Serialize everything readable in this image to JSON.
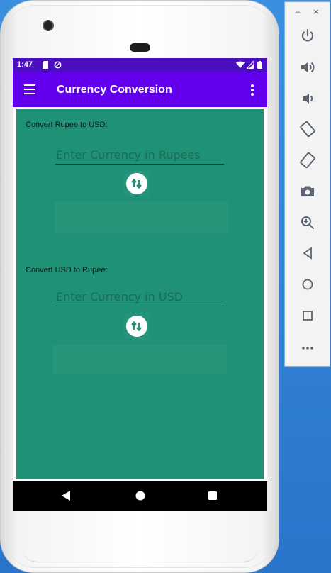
{
  "status_bar": {
    "time": "1:47"
  },
  "app_bar": {
    "title": "Currency Conversion"
  },
  "rupee_to_usd": {
    "label": "Convert Rupee to USD:",
    "input_placeholder": "Enter Currency in Rupees",
    "result": ""
  },
  "usd_to_rupee": {
    "label": "Convert USD to Rupee:",
    "input_placeholder": "Enter Currency in USD",
    "result": ""
  },
  "emulator_toolbar": {
    "minimize": "–",
    "close": "×",
    "buttons": [
      "power-icon",
      "volume-up-icon",
      "volume-down-icon",
      "rotate-left-icon",
      "rotate-right-icon",
      "camera-icon",
      "zoom-icon",
      "back-icon",
      "home-icon",
      "overview-icon",
      "more-icon"
    ]
  },
  "colors": {
    "status_bar": "#4b0fc0",
    "app_bar": "#6200ee",
    "content_bg": "#1e9176"
  }
}
